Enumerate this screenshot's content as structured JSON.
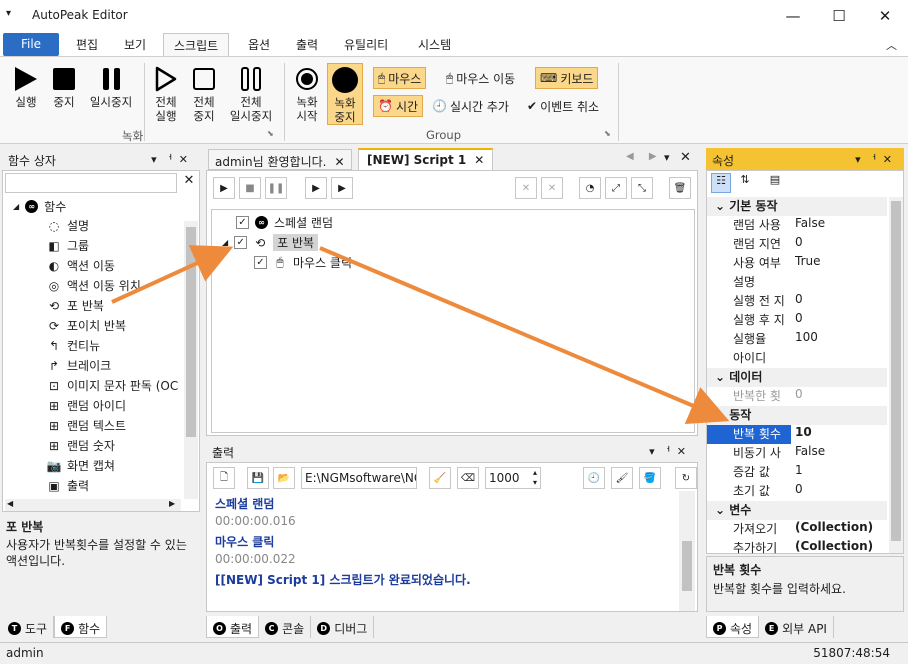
{
  "app": {
    "title": "AutoPeak Editor"
  },
  "window": {
    "min": "—",
    "max": "☐",
    "close": "✕"
  },
  "ribbon_tabs": [
    "File",
    "편집",
    "보기",
    "스크립트",
    "옵션",
    "출력",
    "유틸리티",
    "시스템"
  ],
  "ribbon": {
    "buttons": [
      "실행",
      "중지",
      "일시중지",
      "전체\n실행",
      "전체\n중지",
      "전체\n일시중지",
      "녹화\n시작",
      "녹화\n중지"
    ],
    "small": {
      "mouse": "마우스",
      "mouse_move": "마우스 이동",
      "keyboard": "키보드",
      "time": "시간",
      "realtime_add": "실시간 추가",
      "event_cancel": "이벤트 취소"
    },
    "groups": {
      "record": "녹화",
      "group": "Group"
    }
  },
  "left_panel": {
    "title": "함수 상자",
    "root": "함수",
    "items": [
      "설명",
      "그룹",
      "액션 이동",
      "액션 이동 위치",
      "포 반복",
      "포이치 반복",
      "컨티뉴",
      "브레이크",
      "이미지 문자 판독 (OC",
      "랜덤 아이디",
      "랜덤 텍스트",
      "랜덤 숫자",
      "화면 캡쳐",
      "출력"
    ],
    "desc_title": "포 반복",
    "desc_text": "사용자가 반복횟수를 설정할 수 있는 액션입니다.",
    "tabs": [
      "도구",
      "함수"
    ]
  },
  "editor": {
    "tabs": [
      "admin님 환영합니다.",
      "[NEW] Script 1"
    ],
    "tree": [
      {
        "label": "스페셜 랜덤"
      },
      {
        "label": "포 반복"
      },
      {
        "label": "마우스 클릭"
      }
    ]
  },
  "output": {
    "title": "출력",
    "path": "E:\\NGMsoftware\\NG",
    "count": "1000",
    "lines": [
      {
        "text": "스페셜 랜덤",
        "color": "#1b3c9c",
        "bold": true
      },
      {
        "text": "00:00:00.016",
        "color": "#888888",
        "bold": false
      },
      {
        "text": "마우스 클릭",
        "color": "#1b3c9c",
        "bold": true
      },
      {
        "text": "00:00:00.022",
        "color": "#888888",
        "bold": false
      },
      {
        "text": "[[NEW] Script 1] 스크립트가 완료되었습니다.",
        "color": "#1b3c9c",
        "bold": true
      }
    ],
    "tabs": [
      "출력",
      "콘솔",
      "디버그"
    ]
  },
  "properties": {
    "title": "속성",
    "categories": [
      {
        "name": "기본 동작",
        "rows": [
          [
            "랜덤 사용",
            "False"
          ],
          [
            "랜덤 지연",
            "0"
          ],
          [
            "사용 여부",
            "True"
          ],
          [
            "설명",
            ""
          ],
          [
            "실행 전 지",
            "0"
          ],
          [
            "실행 후 지",
            "0"
          ],
          [
            "실행율",
            "100"
          ],
          [
            "아이디",
            ""
          ]
        ]
      },
      {
        "name": "데이터",
        "rows": [
          [
            "반복한 횟",
            "0"
          ]
        ]
      },
      {
        "name": "동작",
        "rows": [
          [
            "반복 횟수",
            "10"
          ],
          [
            "비동기 사",
            "False"
          ],
          [
            "증감 값",
            "1"
          ],
          [
            "초기 값",
            "0"
          ]
        ]
      },
      {
        "name": "변수",
        "rows": [
          [
            "가져오기",
            "(Collection)"
          ],
          [
            "추가하기",
            "(Collection)"
          ]
        ]
      }
    ],
    "desc_title": "반복 횟수",
    "desc_text": "반복할 횟수를 입력하세요.",
    "tabs": [
      "속성",
      "외부 API"
    ]
  },
  "status": {
    "user": "admin",
    "time": "51807:48:54"
  },
  "colors": {
    "accent": "#2b6cc4",
    "arrow": "#ee8a3c",
    "highlight": "#fbd889"
  }
}
